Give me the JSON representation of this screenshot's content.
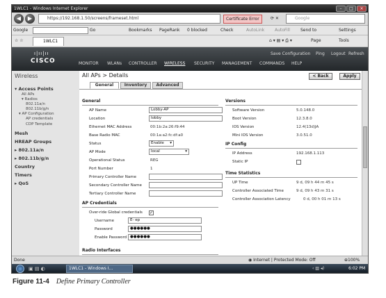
{
  "browser": {
    "window_title": "1WLC1 - Windows Internet Explorer",
    "url": "https://192.168.1.50/screens/frameset.html",
    "cert_error": "Certificate Error",
    "search_placeholder": "Google",
    "toolbar": {
      "google_label": "Google",
      "go_label": "Go",
      "bookmarks_label": "Bookmarks",
      "pagerank_label": "PageRank",
      "blocked_label": "0 blocked",
      "check_label": "Check",
      "autolink_label": "AutoLink",
      "autofill_label": "AutoFill",
      "send_label": "Send to",
      "settings_label": "Settings"
    },
    "tab_label": "1WLC1",
    "page_menu": "Page",
    "tools_menu": "Tools"
  },
  "wlc": {
    "top_links": [
      "Save Configuration",
      "Ping",
      "Logout",
      "Refresh"
    ],
    "menu": [
      "MONITOR",
      "WLANs",
      "CONTROLLER",
      "WIRELESS",
      "SECURITY",
      "MANAGEMENT",
      "COMMANDS",
      "HELP"
    ],
    "sidebar": {
      "title": "Wireless",
      "access_points": "Access Points",
      "all_aps": "All APs",
      "radios": "Radios",
      "radio_a": "802.11a/n",
      "radio_bg": "802.11b/g/n",
      "ap_config": "AP Configuration",
      "ap_credentials": "AP credentials",
      "cdp_template": "CDP Template",
      "mesh": "Mesh",
      "hreap": "HREAP Groups",
      "net_a": "802.11a/n",
      "net_bg": "802.11b/g/n",
      "country": "Country",
      "timers": "Timers",
      "qos": "QoS"
    },
    "page_title": "All APs > Details",
    "back_button": "< Back",
    "apply_button": "Apply",
    "tabs": [
      "General",
      "Inventory",
      "Advanced"
    ],
    "general": {
      "heading": "General",
      "ap_name_label": "AP Name",
      "ap_name": "Lobby-AP",
      "location_label": "Location",
      "location": "lobby",
      "eth_mac_label": "Ethernet MAC Address",
      "eth_mac": "00:1b:2a:26:f9:44",
      "radio_mac_label": "Base Radio MAC",
      "radio_mac": "00:1a:a2:fc:df:a0",
      "status_label": "Status",
      "status": "Enable",
      "mode_label": "AP Mode",
      "mode": "local",
      "op_status_label": "Operational Status",
      "op_status": "REG",
      "port_label": "Port Number",
      "port": "1",
      "primary_label": "Primary Controller Name",
      "secondary_label": "Secondary Controller Name",
      "tertiary_label": "Tertiary Controller Name"
    },
    "credentials": {
      "heading": "AP Credentials",
      "override_label": "Over-ride Global credentials",
      "override_checked": "✓",
      "username_label": "Username",
      "username": "E-     ep",
      "password_label": "Password",
      "password": "●●●●●●",
      "enable_label": "Enable Password",
      "enable_password": "●●●●●●"
    },
    "radio_interfaces": "Radio Interfaces",
    "versions": {
      "heading": "Versions",
      "sw_label": "Software Version",
      "sw": "5.0.148.0",
      "boot_label": "Boot Version",
      "boot": "12.3.8.0",
      "ios_label": "IOS Version",
      "ios": "12.4(13d)JA",
      "mini_label": "Mini IOS Version",
      "mini": "3.0.51.0"
    },
    "ip_config": {
      "heading": "IP Config",
      "ip_label": "IP Address",
      "ip": "192.168.1.113",
      "static_label": "Static IP"
    },
    "time_stats": {
      "heading": "Time Statistics",
      "up_label": "UP Time",
      "up": "9 d, 09 h 44 m 45 s",
      "assoc_label": "Controller Associated Time",
      "assoc": "9 d, 09 h 43 m 31 s",
      "latency_label": "Controller Association Latency",
      "latency": "0 d, 00 h 01 m 13 s"
    }
  },
  "statusbar": {
    "left": "Done",
    "zone": "Internet | Protected Mode: Off",
    "zoom": "100%"
  },
  "taskbar": {
    "task": "1WLC1 - Windows I...",
    "clock": "6:02 PM"
  },
  "caption": {
    "figure": "Figure 11-4",
    "title": "Define Primary Controller"
  },
  "colors": {
    "cisco_header": "#23272a",
    "taskbar": "#101820"
  }
}
